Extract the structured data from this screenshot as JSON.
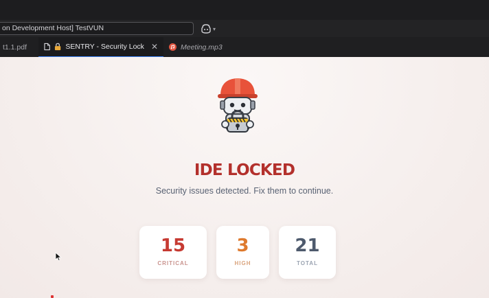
{
  "window": {
    "command_center_text": "on Development Host] TestVUN"
  },
  "tabs": [
    {
      "label": "t1.1.pdf",
      "icon": "pdf-file-icon",
      "active": false
    },
    {
      "label": "SENTRY - Security Lock",
      "icon": "lock-icon",
      "active": true
    },
    {
      "label": "Meeting.mp3",
      "icon": "audio-file-icon",
      "active": false
    }
  ],
  "lock_screen": {
    "title": "IDE LOCKED",
    "subtitle": "Security issues detected. Fix them to continue.",
    "stats": [
      {
        "value": "15",
        "label": "CRITICAL",
        "color": "#c63a32"
      },
      {
        "value": "3",
        "label": "HIGH",
        "color": "#de7a2e"
      },
      {
        "value": "21",
        "label": "TOTAL",
        "color": "#4e5a6d"
      }
    ]
  },
  "colors": {
    "accent_red": "#b3302c",
    "tab_active_border": "#3b82f6"
  }
}
